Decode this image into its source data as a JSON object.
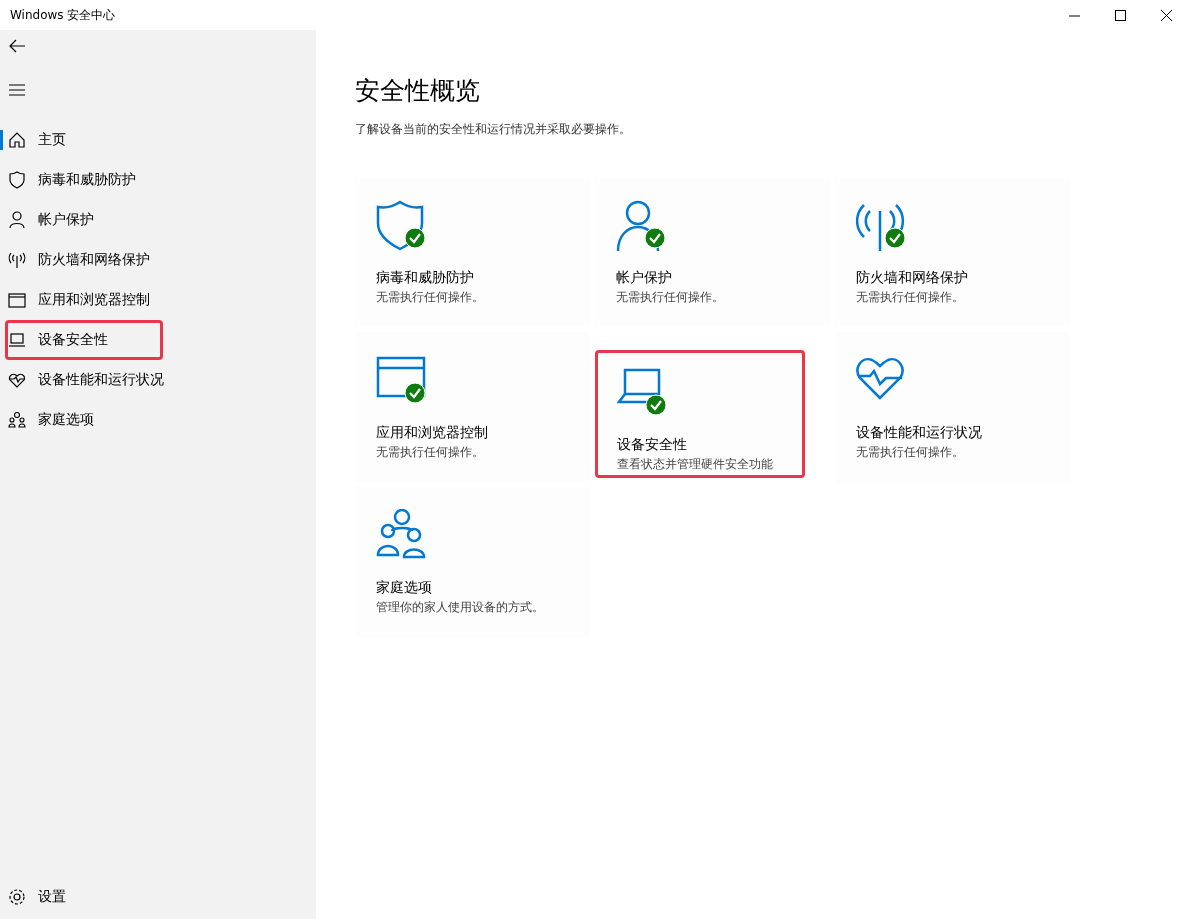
{
  "window": {
    "title": "Windows 安全中心"
  },
  "sidebar": {
    "items": [
      {
        "label": "主页",
        "selected": true,
        "highlighted": false
      },
      {
        "label": "病毒和威胁防护",
        "selected": false,
        "highlighted": false
      },
      {
        "label": "帐户保护",
        "selected": false,
        "highlighted": false
      },
      {
        "label": "防火墙和网络保护",
        "selected": false,
        "highlighted": false
      },
      {
        "label": "应用和浏览器控制",
        "selected": false,
        "highlighted": false
      },
      {
        "label": "设备安全性",
        "selected": false,
        "highlighted": true
      },
      {
        "label": "设备性能和运行状况",
        "selected": false,
        "highlighted": false
      },
      {
        "label": "家庭选项",
        "selected": false,
        "highlighted": false
      }
    ],
    "settings": "设置"
  },
  "main": {
    "title": "安全性概览",
    "subtitle": "了解设备当前的安全性和运行情况并采取必要操作。",
    "cards": [
      {
        "title": "病毒和威胁防护",
        "description": "无需执行任何操作。",
        "ok": true,
        "highlighted": false
      },
      {
        "title": "帐户保护",
        "description": "无需执行任何操作。",
        "ok": true,
        "highlighted": false
      },
      {
        "title": "防火墙和网络保护",
        "description": "无需执行任何操作。",
        "ok": true,
        "highlighted": false
      },
      {
        "title": "应用和浏览器控制",
        "description": "无需执行任何操作。",
        "ok": true,
        "highlighted": false
      },
      {
        "title": "设备安全性",
        "description": "查看状态并管理硬件安全功能",
        "ok": true,
        "highlighted": true
      },
      {
        "title": "设备性能和运行状况",
        "description": "无需执行任何操作。",
        "ok": false,
        "highlighted": false
      },
      {
        "title": "家庭选项",
        "description": "管理你的家人使用设备的方式。",
        "ok": false,
        "highlighted": false
      }
    ]
  }
}
